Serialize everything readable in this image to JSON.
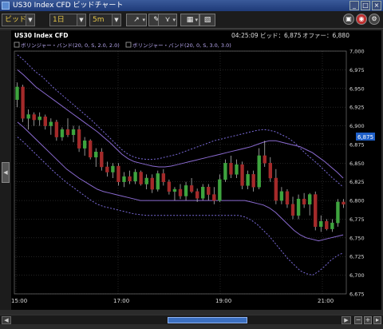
{
  "window": {
    "title": "US30 Index CFD ビッドチャート",
    "controls": [
      "_",
      "□",
      "×"
    ]
  },
  "toolbar": {
    "price_type": "ビッド",
    "period": "1日",
    "interval": "5m",
    "tool_icons": [
      "drawing-tool-icon",
      "pin-icon",
      "indicator-icon",
      "chart-type-icon",
      "image-export-icon"
    ],
    "right_icons": [
      "alert-icon",
      "help-icon",
      "settings-icon"
    ]
  },
  "chart": {
    "symbol": "US30 Index CFD",
    "time": "04:25:09",
    "bid_label": "ビッド：6,875",
    "offer_label": "オファー：6,880",
    "current_price_tag": "6,875",
    "indicators": [
      "ボリンジャー・バンド(20, 0, S, 2.0, 2.0)",
      "ボリンジャー・バンド(20, 0, S, 3.0, 3.0)"
    ],
    "y_ticks": [
      "7,000",
      "6,975",
      "6,950",
      "6,925",
      "6,900",
      "6,875",
      "6,850",
      "6,825",
      "6,800",
      "6,775",
      "6,750",
      "6,725",
      "6,700",
      "6,675"
    ],
    "x_ticks": [
      "15:00",
      "17:00",
      "19:00",
      "21:00"
    ]
  },
  "colors": {
    "up_candle": "#3ea43e",
    "down_candle": "#a42a2a",
    "band_2sd": "#8a6ad0",
    "band_3sd": "#6a5ac0",
    "grid": "#4a4a4a",
    "price_tag": "#1e5fc8"
  },
  "chart_data": {
    "type": "candlestick",
    "ylim": [
      6675,
      7000
    ],
    "x_ticks": [
      "15:00",
      "17:00",
      "19:00",
      "21:00"
    ],
    "candles": [
      {
        "o": 6935,
        "h": 6958,
        "l": 6925,
        "c": 6952
      },
      {
        "o": 6952,
        "h": 6955,
        "l": 6905,
        "c": 6910
      },
      {
        "o": 6910,
        "h": 6922,
        "l": 6895,
        "c": 6915
      },
      {
        "o": 6915,
        "h": 6918,
        "l": 6900,
        "c": 6908
      },
      {
        "o": 6908,
        "h": 6918,
        "l": 6900,
        "c": 6912
      },
      {
        "o": 6912,
        "h": 6915,
        "l": 6895,
        "c": 6900
      },
      {
        "o": 6900,
        "h": 6910,
        "l": 6888,
        "c": 6905
      },
      {
        "o": 6905,
        "h": 6908,
        "l": 6880,
        "c": 6885
      },
      {
        "o": 6885,
        "h": 6898,
        "l": 6880,
        "c": 6895
      },
      {
        "o": 6895,
        "h": 6910,
        "l": 6885,
        "c": 6888
      },
      {
        "o": 6888,
        "h": 6900,
        "l": 6878,
        "c": 6895
      },
      {
        "o": 6895,
        "h": 6900,
        "l": 6865,
        "c": 6870
      },
      {
        "o": 6870,
        "h": 6885,
        "l": 6860,
        "c": 6880
      },
      {
        "o": 6880,
        "h": 6882,
        "l": 6855,
        "c": 6858
      },
      {
        "o": 6858,
        "h": 6870,
        "l": 6845,
        "c": 6865
      },
      {
        "o": 6865,
        "h": 6870,
        "l": 6840,
        "c": 6845
      },
      {
        "o": 6845,
        "h": 6852,
        "l": 6832,
        "c": 6838
      },
      {
        "o": 6838,
        "h": 6850,
        "l": 6830,
        "c": 6846
      },
      {
        "o": 6846,
        "h": 6850,
        "l": 6820,
        "c": 6825
      },
      {
        "o": 6825,
        "h": 6838,
        "l": 6818,
        "c": 6832
      },
      {
        "o": 6832,
        "h": 6840,
        "l": 6822,
        "c": 6826
      },
      {
        "o": 6826,
        "h": 6842,
        "l": 6822,
        "c": 6838
      },
      {
        "o": 6838,
        "h": 6840,
        "l": 6820,
        "c": 6822
      },
      {
        "o": 6822,
        "h": 6835,
        "l": 6815,
        "c": 6830
      },
      {
        "o": 6830,
        "h": 6835,
        "l": 6810,
        "c": 6815
      },
      {
        "o": 6815,
        "h": 6840,
        "l": 6812,
        "c": 6836
      },
      {
        "o": 6836,
        "h": 6842,
        "l": 6820,
        "c": 6825
      },
      {
        "o": 6825,
        "h": 6828,
        "l": 6808,
        "c": 6812
      },
      {
        "o": 6812,
        "h": 6818,
        "l": 6800,
        "c": 6815
      },
      {
        "o": 6815,
        "h": 6822,
        "l": 6802,
        "c": 6806
      },
      {
        "o": 6806,
        "h": 6825,
        "l": 6800,
        "c": 6820
      },
      {
        "o": 6820,
        "h": 6830,
        "l": 6810,
        "c": 6812
      },
      {
        "o": 6812,
        "h": 6816,
        "l": 6798,
        "c": 6803
      },
      {
        "o": 6803,
        "h": 6822,
        "l": 6800,
        "c": 6818
      },
      {
        "o": 6818,
        "h": 6822,
        "l": 6800,
        "c": 6808
      },
      {
        "o": 6808,
        "h": 6818,
        "l": 6795,
        "c": 6800
      },
      {
        "o": 6800,
        "h": 6835,
        "l": 6798,
        "c": 6828
      },
      {
        "o": 6828,
        "h": 6855,
        "l": 6825,
        "c": 6850
      },
      {
        "o": 6850,
        "h": 6860,
        "l": 6830,
        "c": 6835
      },
      {
        "o": 6835,
        "h": 6855,
        "l": 6830,
        "c": 6848
      },
      {
        "o": 6848,
        "h": 6852,
        "l": 6815,
        "c": 6820
      },
      {
        "o": 6820,
        "h": 6840,
        "l": 6815,
        "c": 6835
      },
      {
        "o": 6835,
        "h": 6840,
        "l": 6812,
        "c": 6818
      },
      {
        "o": 6818,
        "h": 6870,
        "l": 6815,
        "c": 6860
      },
      {
        "o": 6860,
        "h": 6880,
        "l": 6845,
        "c": 6850
      },
      {
        "o": 6850,
        "h": 6858,
        "l": 6825,
        "c": 6830
      },
      {
        "o": 6830,
        "h": 6842,
        "l": 6795,
        "c": 6800
      },
      {
        "o": 6800,
        "h": 6818,
        "l": 6795,
        "c": 6812
      },
      {
        "o": 6812,
        "h": 6815,
        "l": 6790,
        "c": 6795
      },
      {
        "o": 6795,
        "h": 6805,
        "l": 6775,
        "c": 6780
      },
      {
        "o": 6780,
        "h": 6808,
        "l": 6775,
        "c": 6802
      },
      {
        "o": 6802,
        "h": 6810,
        "l": 6790,
        "c": 6795
      },
      {
        "o": 6795,
        "h": 6810,
        "l": 6780,
        "c": 6808
      },
      {
        "o": 6808,
        "h": 6812,
        "l": 6760,
        "c": 6765
      },
      {
        "o": 6765,
        "h": 6780,
        "l": 6758,
        "c": 6772
      },
      {
        "o": 6772,
        "h": 6775,
        "l": 6760,
        "c": 6762
      },
      {
        "o": 6762,
        "h": 6775,
        "l": 6758,
        "c": 6770
      },
      {
        "o": 6770,
        "h": 6802,
        "l": 6765,
        "c": 6798
      },
      {
        "o": 6798,
        "h": 6802,
        "l": 6790,
        "c": 6795
      }
    ],
    "upper_2sd": [
      6975,
      6968,
      6960,
      6952,
      6946,
      6940,
      6934,
      6928,
      6922,
      6916,
      6910,
      6904,
      6898,
      6892,
      6885,
      6878,
      6870,
      6862,
      6856,
      6852,
      6850,
      6848,
      6846,
      6845,
      6845,
      6846,
      6848,
      6850,
      6852,
      6854,
      6856,
      6858,
      6860,
      6862,
      6864,
      6866,
      6868,
      6870,
      6872,
      6875,
      6878,
      6880,
      6880,
      6878,
      6876,
      6874,
      6872,
      6868,
      6864,
      6858,
      6852,
      6845,
      6838,
      6830
    ],
    "lower_2sd": [
      6905,
      6898,
      6890,
      6882,
      6874,
      6866,
      6858,
      6850,
      6842,
      6836,
      6830,
      6825,
      6820,
      6815,
      6812,
      6810,
      6808,
      6806,
      6804,
      6802,
      6800,
      6800,
      6800,
      6800,
      6800,
      6800,
      6800,
      6800,
      6800,
      6800,
      6800,
      6800,
      6800,
      6800,
      6800,
      6800,
      6800,
      6800,
      6798,
      6796,
      6794,
      6790,
      6784,
      6776,
      6768,
      6760,
      6754,
      6750,
      6748,
      6746,
      6748,
      6750,
      6752,
      6754
    ],
    "upper_3sd": [
      6995,
      6988,
      6980,
      6972,
      6966,
      6958,
      6950,
      6943,
      6936,
      6929,
      6922,
      6915,
      6908,
      6900,
      6892,
      6884,
      6876,
      6868,
      6862,
      6858,
      6856,
      6855,
      6855,
      6856,
      6858,
      6860,
      6862,
      6865,
      6868,
      6871,
      6874,
      6877,
      6880,
      6882,
      6884,
      6886,
      6888,
      6890,
      6892,
      6894,
      6895,
      6894,
      6892,
      6888,
      6884,
      6878,
      6870,
      6862,
      6855,
      6848,
      6840,
      6832,
      6825,
      6818
    ],
    "lower_3sd": [
      6885,
      6878,
      6870,
      6862,
      6854,
      6846,
      6838,
      6831,
      6824,
      6818,
      6812,
      6806,
      6800,
      6795,
      6792,
      6790,
      6788,
      6786,
      6784,
      6782,
      6781,
      6780,
      6780,
      6780,
      6780,
      6780,
      6780,
      6780,
      6780,
      6780,
      6780,
      6780,
      6780,
      6780,
      6780,
      6780,
      6780,
      6778,
      6774,
      6768,
      6760,
      6752,
      6742,
      6732,
      6722,
      6714,
      6706,
      6702,
      6700,
      6705,
      6712,
      6720,
      6726,
      6730
    ]
  }
}
